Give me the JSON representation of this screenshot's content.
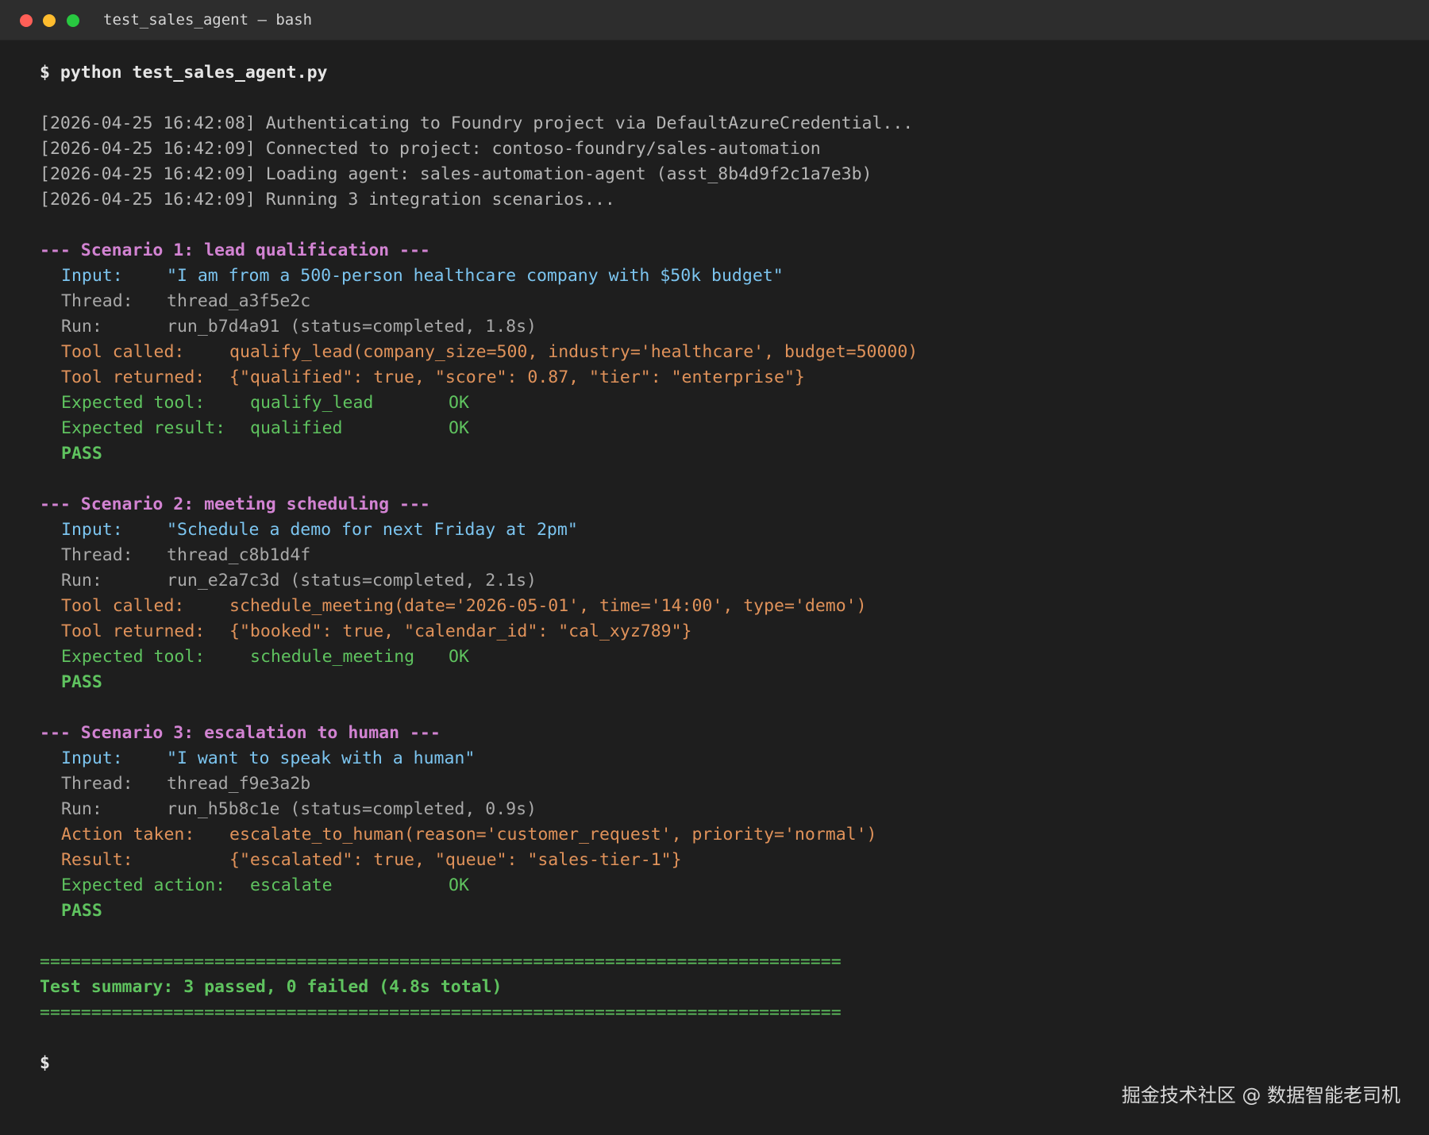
{
  "window": {
    "title": "test_sales_agent — bash"
  },
  "terminal": {
    "command_prompt": "$",
    "command": "python test_sales_agent.py",
    "logs": [
      "[2026-04-25 16:42:08] Authenticating to Foundry project via DefaultAzureCredential...",
      "[2026-04-25 16:42:09] Connected to project: contoso-foundry/sales-automation",
      "[2026-04-25 16:42:09] Loading agent: sales-automation-agent (asst_8b4d9f2c1a7e3b)",
      "[2026-04-25 16:42:09] Running 3 integration scenarios..."
    ],
    "scenarios": [
      {
        "header": "--- Scenario 1: lead qualification ---",
        "input_label": "Input:",
        "input_value": "\"I am from a 500-person healthcare company with $50k budget\"",
        "thread_label": "Thread:",
        "thread_value": "thread_a3f5e2c",
        "run_label": "Run:",
        "run_value": "run_b7d4a91 (status=completed, 1.8s)",
        "tool_label": "Tool called:",
        "tool_value": "qualify_lead(company_size=500, industry='healthcare', budget=50000)",
        "returned_label": "Tool returned:",
        "returned_value": "{\"qualified\": true, \"score\": 0.87, \"tier\": \"enterprise\"}",
        "checks": [
          {
            "label": "Expected tool:",
            "value": "qualify_lead",
            "status": "OK"
          },
          {
            "label": "Expected result:",
            "value": "qualified",
            "status": "OK"
          }
        ],
        "result": "PASS"
      },
      {
        "header": "--- Scenario 2: meeting scheduling ---",
        "input_label": "Input:",
        "input_value": "\"Schedule a demo for next Friday at 2pm\"",
        "thread_label": "Thread:",
        "thread_value": "thread_c8b1d4f",
        "run_label": "Run:",
        "run_value": "run_e2a7c3d (status=completed, 2.1s)",
        "tool_label": "Tool called:",
        "tool_value": "schedule_meeting(date='2026-05-01', time='14:00', type='demo')",
        "returned_label": "Tool returned:",
        "returned_value": "{\"booked\": true, \"calendar_id\": \"cal_xyz789\"}",
        "checks": [
          {
            "label": "Expected tool:",
            "value": "schedule_meeting",
            "status": "OK"
          }
        ],
        "result": "PASS"
      },
      {
        "header": "--- Scenario 3: escalation to human ---",
        "input_label": "Input:",
        "input_value": "\"I want to speak with a human\"",
        "thread_label": "Thread:",
        "thread_value": "thread_f9e3a2b",
        "run_label": "Run:",
        "run_value": "run_h5b8c1e (status=completed, 0.9s)",
        "tool_label": "Action taken:",
        "tool_value": "escalate_to_human(reason='customer_request', priority='normal')",
        "returned_label": "Result:",
        "returned_value": "{\"escalated\": true, \"queue\": \"sales-tier-1\"}",
        "checks": [
          {
            "label": "Expected action:",
            "value": "escalate",
            "status": "OK"
          }
        ],
        "result": "PASS"
      }
    ],
    "separator": "==============================================================================",
    "summary": "Test summary: 3 passed, 0 failed (4.8s total)",
    "final_prompt": "$"
  },
  "watermark": "掘金技术社区 @ 数据智能老司机",
  "colors": {
    "background": "#1e1e1e",
    "titlebar": "#2d2d2d",
    "scenario_header": "#d283d2",
    "input": "#7cc5f0",
    "tool": "#e0925a",
    "success": "#5fc35f"
  }
}
